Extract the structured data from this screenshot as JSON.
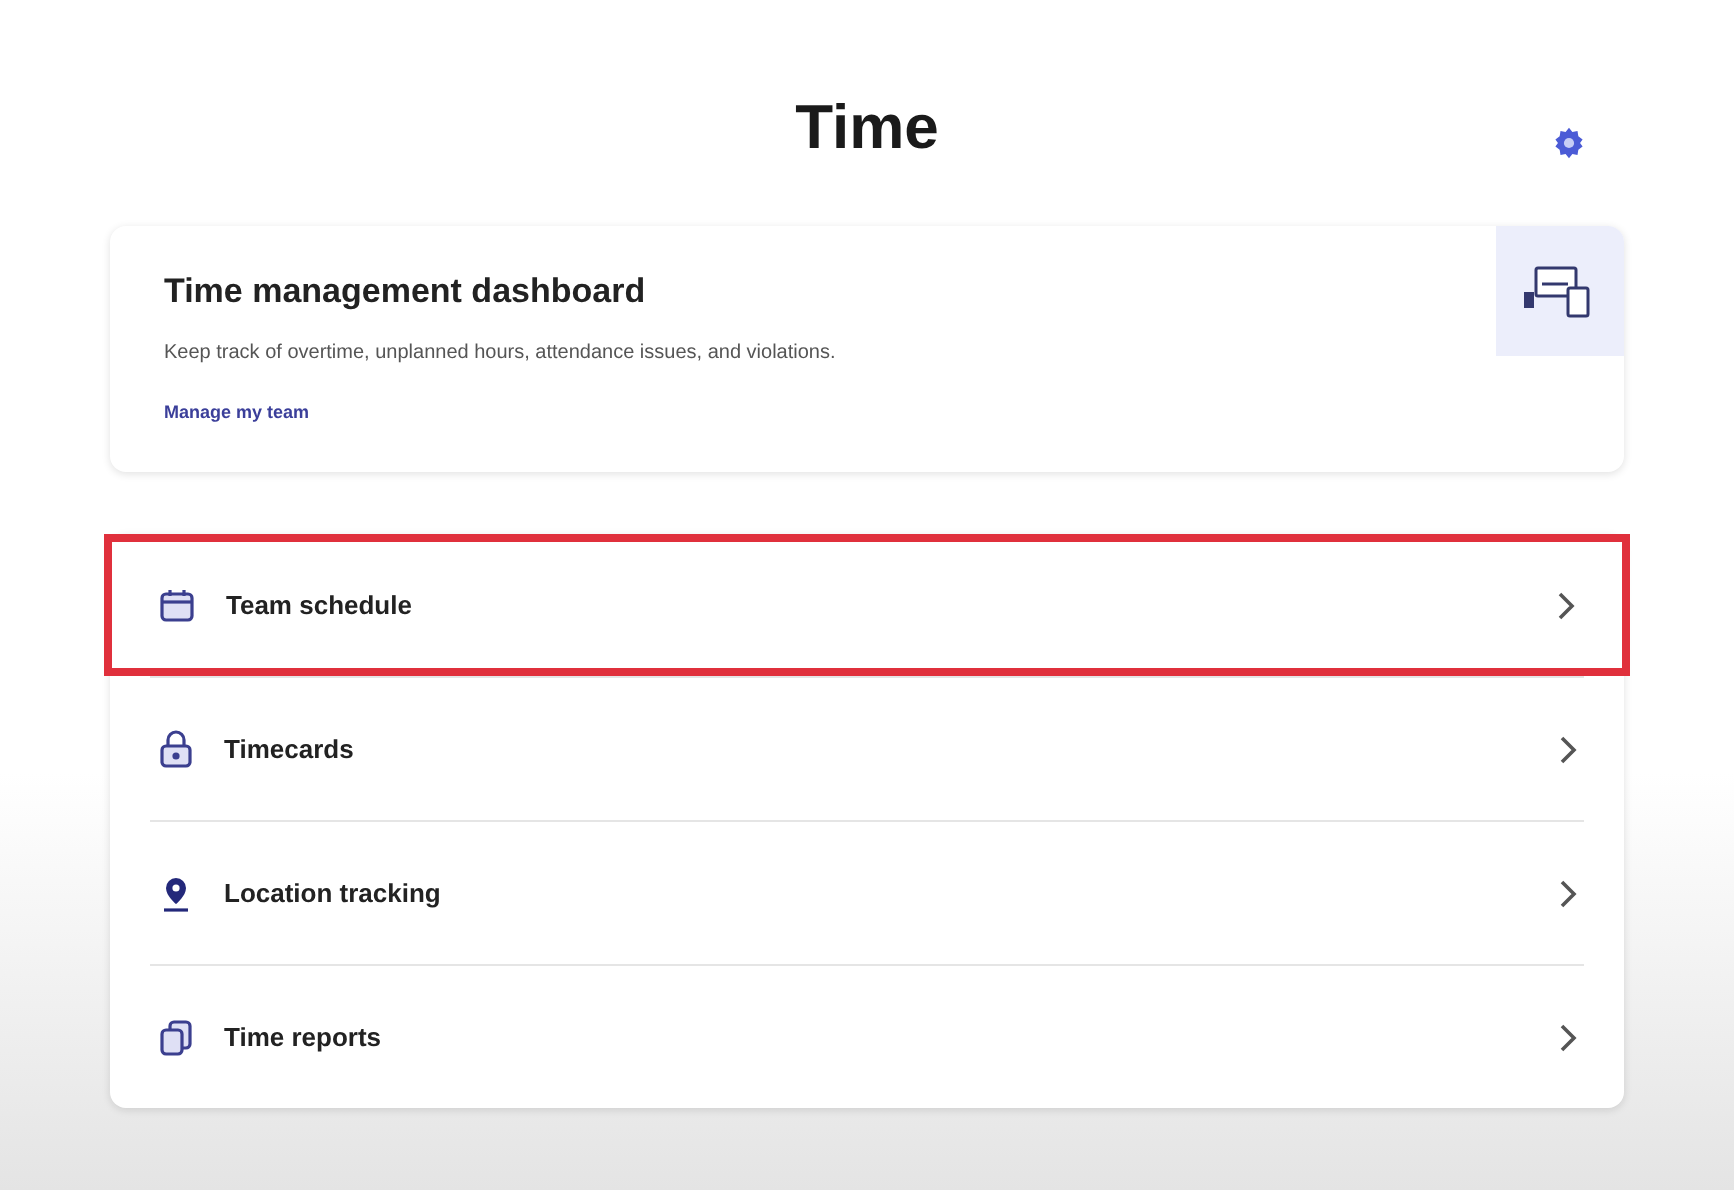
{
  "header": {
    "title": "Time"
  },
  "dashboard_card": {
    "title": "Time management dashboard",
    "description": "Keep track of overtime, unplanned hours, attendance issues, and violations.",
    "link": "Manage my team"
  },
  "menu_items": [
    {
      "kind": "calendar",
      "label": "Team schedule",
      "highlighted": true
    },
    {
      "kind": "timecard",
      "label": "Timecards",
      "highlighted": false
    },
    {
      "kind": "location",
      "label": "Location tracking",
      "highlighted": false
    },
    {
      "kind": "report",
      "label": "Time reports",
      "highlighted": false
    }
  ]
}
